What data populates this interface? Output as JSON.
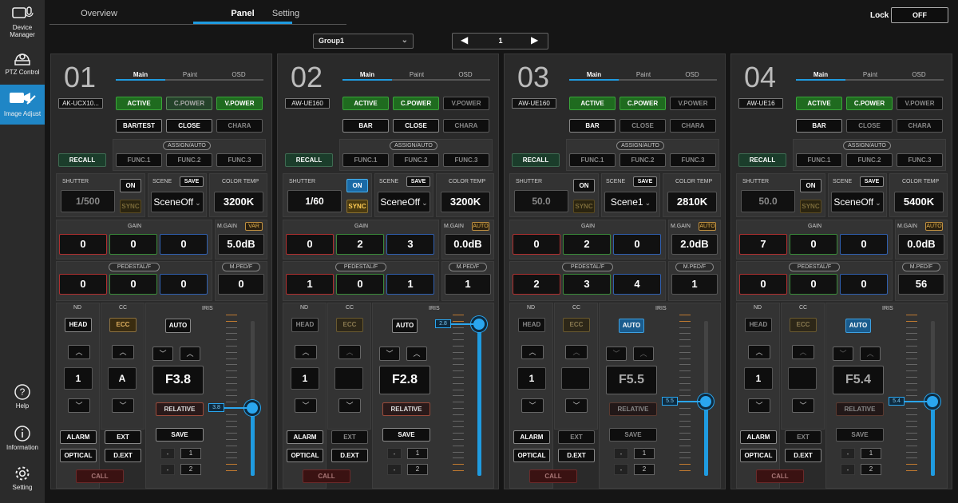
{
  "sidebar": {
    "items": [
      {
        "label": "Device Manager",
        "icon": "camera-mic-icon"
      },
      {
        "label": "PTZ Control",
        "icon": "ptz-camera-icon"
      },
      {
        "label": "Image Adjust",
        "icon": "camera-adjust-icon",
        "active": true
      },
      {
        "label": "Help",
        "icon": "help-icon"
      },
      {
        "label": "Information",
        "icon": "info-icon"
      },
      {
        "label": "Setting",
        "icon": "gear-icon"
      }
    ]
  },
  "top_tabs": [
    "Overview",
    "Panel",
    "Setting"
  ],
  "active_top_tab": "Panel",
  "lock": {
    "label": "Lock",
    "value": "OFF"
  },
  "group": {
    "value": "Group1"
  },
  "pager": {
    "page": "1",
    "prev": "◀",
    "next": "▶"
  },
  "panel_tabs": [
    "Main",
    "Paint",
    "OSD"
  ],
  "labels": {
    "active": "ACTIVE",
    "cpower": "C.POWER",
    "vpower": "V.POWER",
    "bar": "BAR",
    "bartest": "BAR/TEST",
    "close": "CLOSE",
    "chara": "CHARA",
    "recall": "RECALL",
    "assign": "ASSIGN/AUTO",
    "func1": "FUNC.1",
    "func2": "FUNC.2",
    "func3": "FUNC.3",
    "shutter": "SHUTTER",
    "on": "ON",
    "sync": "SYNC",
    "scene": "SCENE",
    "save": "SAVE",
    "colortemp": "COLOR TEMP",
    "gain": "GAIN",
    "mgain": "M.GAIN",
    "pedestal": "PEDESTAL/F",
    "mped": "M.PED/F",
    "nd": "ND",
    "cc": "CC",
    "iris": "IRIS",
    "head": "HEAD",
    "ecc": "ECC",
    "auto": "AUTO",
    "relative": "RELATIVE",
    "irissave": "SAVE",
    "alarm": "ALARM",
    "ext": "EXT",
    "optical": "OPTICAL",
    "dext": "D.EXT",
    "call": "CALL",
    "dash": "-",
    "one": "1",
    "two": "2"
  },
  "cameras": [
    {
      "num": "01",
      "model": "AK-UCX10...",
      "bar_label": "BAR/TEST",
      "vpower_on": true,
      "shutter": "1/500",
      "shutter_on": false,
      "sync_on": false,
      "scene": "SceneOff",
      "color_temp": "3200K",
      "gain": [
        "0",
        "0",
        "0"
      ],
      "mgain": "5.0dB",
      "mgain_tag": "VAR",
      "pedestal": [
        "0",
        "0",
        "0"
      ],
      "mped": "0",
      "nd": "1",
      "cc": "A",
      "iris": "F3.8",
      "iris_auto": false,
      "iris_tag": "3.8",
      "iris_level": 0.44
    },
    {
      "num": "02",
      "model": "AW-UE160",
      "bar_label": "BAR",
      "vpower_on": false,
      "shutter": "1/60",
      "shutter_on": true,
      "sync_on": true,
      "scene": "SceneOff",
      "color_temp": "3200K",
      "gain": [
        "0",
        "2",
        "3"
      ],
      "mgain": "0.0dB",
      "mgain_tag": "AUTO",
      "pedestal": [
        "1",
        "0",
        "1"
      ],
      "mped": "1",
      "nd": "1",
      "cc": "",
      "iris": "F2.8",
      "iris_auto": false,
      "iris_tag": "2.8",
      "iris_level": 0.98
    },
    {
      "num": "03",
      "model": "AW-UE160",
      "bar_label": "BAR",
      "vpower_on": false,
      "shutter": "50.0",
      "shutter_on": false,
      "sync_on": false,
      "scene": "Scene1",
      "color_temp": "2810K",
      "gain": [
        "0",
        "2",
        "0"
      ],
      "mgain": "2.0dB",
      "mgain_tag": "AUTO",
      "pedestal": [
        "2",
        "3",
        "4"
      ],
      "mped": "1",
      "nd": "1",
      "cc": "",
      "iris": "F5.5",
      "iris_auto": true,
      "iris_tag": "5.5",
      "iris_level": 0.48
    },
    {
      "num": "04",
      "model": "AW-UE16",
      "bar_label": "BAR",
      "vpower_on": false,
      "shutter": "50.0",
      "shutter_on": false,
      "sync_on": false,
      "scene": "SceneOff",
      "color_temp": "5400K",
      "gain": [
        "7",
        "0",
        "0"
      ],
      "mgain": "0.0dB",
      "mgain_tag": "AUTO",
      "pedestal": [
        "0",
        "0",
        "0"
      ],
      "mped": "56",
      "nd": "1",
      "cc": "",
      "iris": "F5.4",
      "iris_auto": true,
      "iris_tag": "5.4",
      "iris_level": 0.48
    }
  ]
}
